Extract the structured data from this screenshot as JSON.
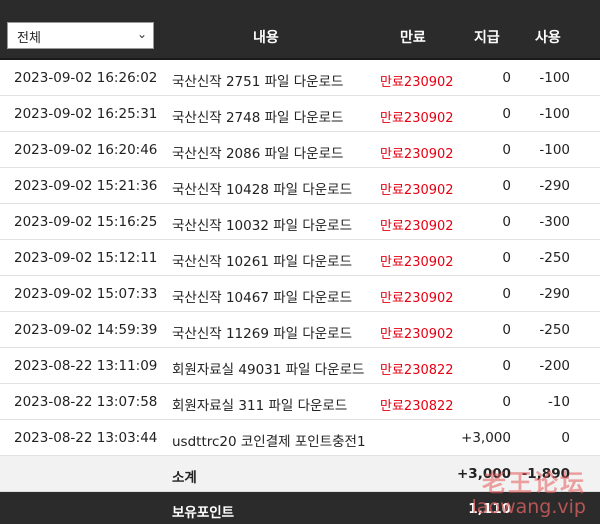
{
  "filter": {
    "selected": "전체",
    "icon": "chevron-down-icon"
  },
  "columns": {
    "content": "내용",
    "expiry": "만료",
    "given": "지급",
    "used": "사용"
  },
  "rows": [
    {
      "datetime": "2023-09-02 16:26:02",
      "content": "국산신작 2751 파일 다운로드",
      "expiry": "만료230902",
      "given": "0",
      "used": "-100"
    },
    {
      "datetime": "2023-09-02 16:25:31",
      "content": "국산신작 2748 파일 다운로드",
      "expiry": "만료230902",
      "given": "0",
      "used": "-100"
    },
    {
      "datetime": "2023-09-02 16:20:46",
      "content": "국산신작 2086 파일 다운로드",
      "expiry": "만료230902",
      "given": "0",
      "used": "-100"
    },
    {
      "datetime": "2023-09-02 15:21:36",
      "content": "국산신작 10428 파일 다운로드",
      "expiry": "만료230902",
      "given": "0",
      "used": "-290"
    },
    {
      "datetime": "2023-09-02 15:16:25",
      "content": "국산신작 10032 파일 다운로드",
      "expiry": "만료230902",
      "given": "0",
      "used": "-300"
    },
    {
      "datetime": "2023-09-02 15:12:11",
      "content": "국산신작 10261 파일 다운로드",
      "expiry": "만료230902",
      "given": "0",
      "used": "-250"
    },
    {
      "datetime": "2023-09-02 15:07:33",
      "content": "국산신작 10467 파일 다운로드",
      "expiry": "만료230902",
      "given": "0",
      "used": "-290"
    },
    {
      "datetime": "2023-09-02 14:59:39",
      "content": "국산신작 11269 파일 다운로드",
      "expiry": "만료230902",
      "given": "0",
      "used": "-250"
    },
    {
      "datetime": "2023-08-22 13:11:09",
      "content": "회원자료실 49031 파일 다운로드",
      "expiry": "만료230822",
      "given": "0",
      "used": "-200"
    },
    {
      "datetime": "2023-08-22 13:07:58",
      "content": "회원자료실 311 파일 다운로드",
      "expiry": "만료230822",
      "given": "0",
      "used": "-10"
    },
    {
      "datetime": "2023-08-22 13:03:44",
      "content": "usdttrc20 코인결제 포인트충전1",
      "expiry": "",
      "given": "+3,000",
      "used": "0"
    }
  ],
  "subtotal": {
    "label": "소계",
    "given": "+3,000",
    "used": "-1,890"
  },
  "balance": {
    "label": "보유포인트",
    "value": "1,110"
  },
  "watermark": {
    "cn": "老王论坛",
    "url": "laowang.vip"
  },
  "colors": {
    "header_bg": "#2b2b2b",
    "expiry_red": "#e60012",
    "subtotal_bg": "#f2f2f2"
  }
}
